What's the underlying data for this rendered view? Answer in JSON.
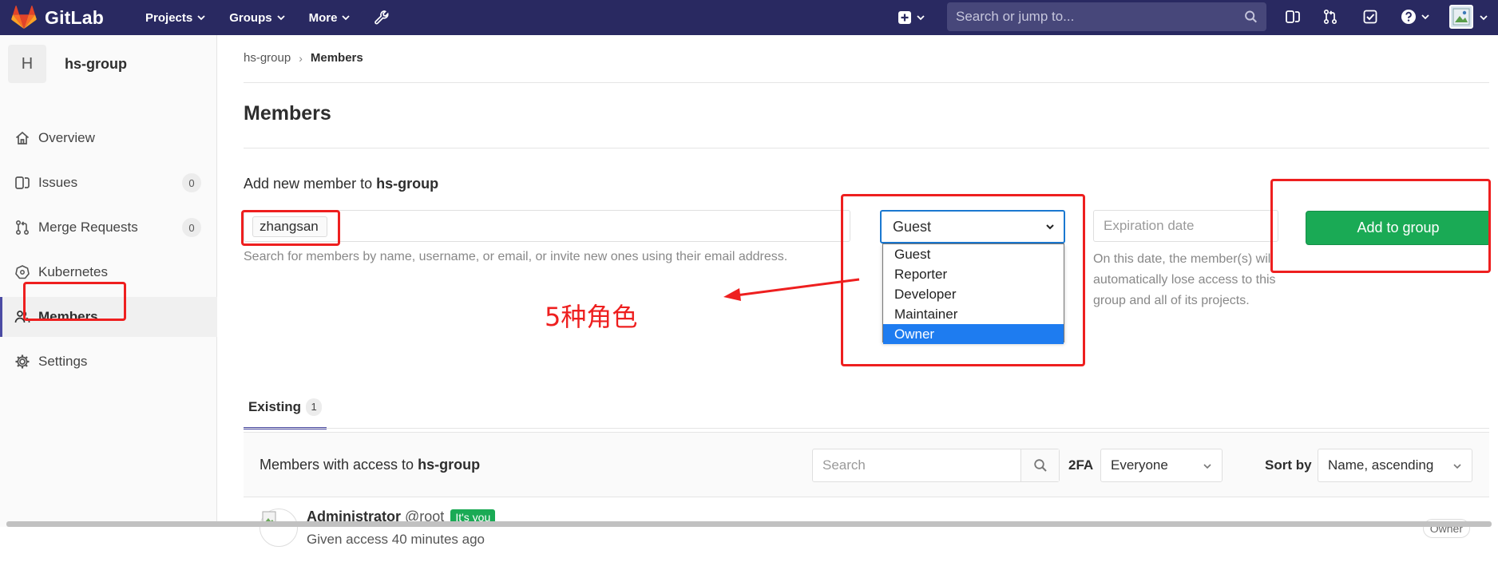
{
  "navbar": {
    "brand": "GitLab",
    "links": [
      {
        "label": "Projects"
      },
      {
        "label": "Groups"
      },
      {
        "label": "More"
      }
    ],
    "search_placeholder": "Search or jump to...",
    "bg_color": "#292961"
  },
  "sidebar": {
    "group_initial": "H",
    "group_name": "hs-group",
    "items": [
      {
        "label": "Overview",
        "icon": "home-icon"
      },
      {
        "label": "Issues",
        "icon": "issues-icon",
        "count": "0"
      },
      {
        "label": "Merge Requests",
        "icon": "merge-request-icon",
        "count": "0"
      },
      {
        "label": "Kubernetes",
        "icon": "kubernetes-icon"
      },
      {
        "label": "Members",
        "icon": "members-icon",
        "active": true
      },
      {
        "label": "Settings",
        "icon": "settings-icon"
      }
    ]
  },
  "breadcrumb": {
    "group": "hs-group",
    "separator": "›",
    "current": "Members"
  },
  "page_title": "Members",
  "add_member": {
    "label_prefix": "Add new member to",
    "group_name": "hs-group",
    "token_value": "zhangsan",
    "help_text": "Search for members by name, username, or email, or invite new ones using their email address.",
    "role_selected": "Guest",
    "role_options": [
      "Guest",
      "Reporter",
      "Developer",
      "Maintainer",
      "Owner"
    ],
    "role_highlighted": "Owner",
    "expiration_placeholder": "Expiration date",
    "expiration_help": "On this date, the member(s) will automatically lose access to this group and all of its projects.",
    "add_button": "Add to group",
    "accent_color": "#1aaa55"
  },
  "annotation": {
    "text": "5种角色",
    "color": "#ee1f1f"
  },
  "tabs": {
    "existing_label": "Existing",
    "existing_count": "1"
  },
  "members_panel": {
    "title_prefix": "Members with access to",
    "group_name": "hs-group",
    "search_placeholder": "Search",
    "twofa_label": "2FA",
    "twofa_value": "Everyone",
    "sort_label": "Sort by",
    "sort_value": "Name, ascending"
  },
  "members": [
    {
      "name": "Administrator",
      "username": "@root",
      "badge": "It's you",
      "meta": "Given access 40 minutes ago",
      "role": "Owner"
    }
  ]
}
